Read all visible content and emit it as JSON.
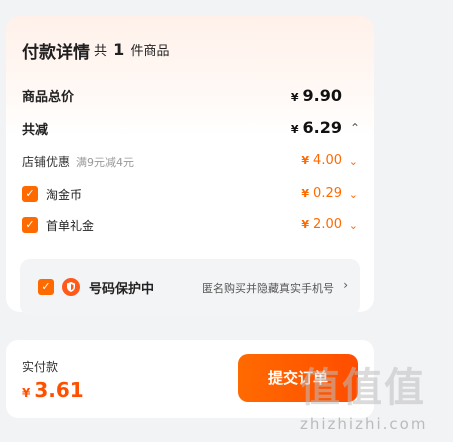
{
  "header": {
    "title": "付款详情",
    "count_prefix": "共",
    "count": "1",
    "count_suffix": "件商品"
  },
  "items_total": {
    "label": "商品总价",
    "currency": "¥",
    "value": "9.90"
  },
  "discount_total": {
    "label": "共减",
    "currency": "¥",
    "value": "6.29"
  },
  "discounts": [
    {
      "label": "店铺优惠",
      "note": "满9元减4元",
      "currency": "¥",
      "value": "4.00",
      "checkbox": false
    },
    {
      "label": "淘金币",
      "currency": "¥",
      "value": "0.29",
      "checkbox": true
    },
    {
      "label": "首单礼金",
      "currency": "¥",
      "value": "2.00",
      "checkbox": true
    }
  ],
  "protection": {
    "title": "号码保护中",
    "description": "匿名购买并隐藏真实手机号"
  },
  "footer": {
    "pay_label": "实付款",
    "currency": "¥",
    "amount": "3.61",
    "submit_label": "提交订单"
  },
  "watermark": {
    "text": "值值值",
    "url": "zhizhizhi.com"
  },
  "colors": {
    "accent": "#ff6a00",
    "price_orange": "#ff5000",
    "card_bg": "#ffffff",
    "page_bg": "#f2f3f5"
  }
}
